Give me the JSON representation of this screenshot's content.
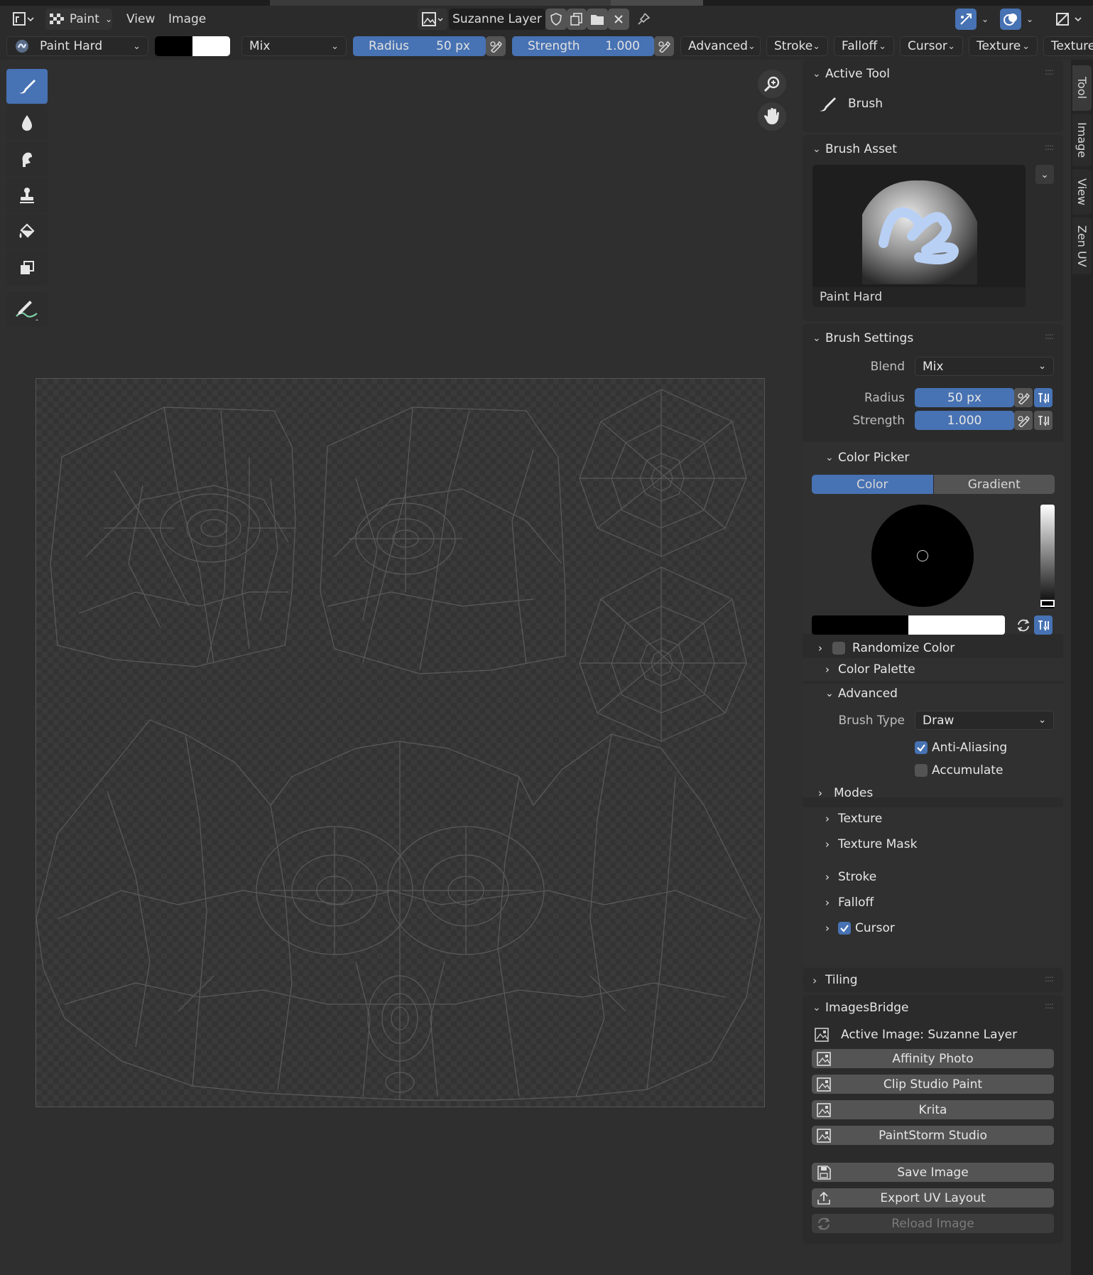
{
  "header": {
    "mode_label": "Paint",
    "menu_view": "View",
    "menu_image": "Image",
    "image_name": "Suzanne Layer"
  },
  "toolsettings": {
    "brush_name": "Paint Hard",
    "blend": "Mix",
    "radius_label": "Radius",
    "radius_value": "50 px",
    "strength_label": "Strength",
    "strength_value": "1.000",
    "menus": [
      "Advanced",
      "Stroke",
      "Falloff",
      "Cursor",
      "Texture",
      "Texture"
    ]
  },
  "toolbar": {
    "tools": [
      "brush-tool-icon",
      "blur-tool-icon",
      "smear-tool-icon",
      "clone-tool-icon",
      "fill-tool-icon",
      "mask-tool-icon",
      "annotate-tool-icon"
    ],
    "active_index": 0
  },
  "sidebar_tabs": [
    "Tool",
    "Image",
    "View",
    "Zen UV"
  ],
  "panels": {
    "active_tool": {
      "title": "Active Tool",
      "tool_name": "Brush"
    },
    "brush_asset": {
      "title": "Brush Asset",
      "asset_name": "Paint Hard"
    },
    "brush_settings": {
      "title": "Brush Settings",
      "blend_label": "Blend",
      "blend_value": "Mix",
      "radius_label": "Radius",
      "radius_value": "50 px",
      "strength_label": "Strength",
      "strength_value": "1.000"
    },
    "color_picker": {
      "title": "Color Picker",
      "tab_color": "Color",
      "tab_gradient": "Gradient",
      "primary_color": "#000000",
      "secondary_color": "#ffffff"
    },
    "randomize_color": "Randomize Color",
    "color_palette": "Color Palette",
    "advanced": {
      "title": "Advanced",
      "brush_type_label": "Brush Type",
      "brush_type_value": "Draw",
      "anti_aliasing": "Anti-Aliasing",
      "anti_aliasing_checked": true,
      "accumulate": "Accumulate",
      "accumulate_checked": false,
      "modes": "Modes"
    },
    "collapsed": [
      "Texture",
      "Texture Mask",
      "Stroke",
      "Falloff"
    ],
    "cursor": {
      "label": "Cursor",
      "checked": true
    },
    "tiling": "Tiling",
    "images_bridge": {
      "title": "ImagesBridge",
      "active_image": "Active Image: Suzanne Layer",
      "apps": [
        "Affinity Photo",
        "Clip Studio Paint",
        "Krita",
        "PaintStorm Studio"
      ],
      "save_image": "Save Image",
      "export_uv": "Export UV Layout",
      "reload_image": "Reload Image"
    }
  },
  "colors": {
    "accent": "#4772b3",
    "bg": "#2f2f2f",
    "panel": "#2b2b2b",
    "widget": "#545454"
  }
}
